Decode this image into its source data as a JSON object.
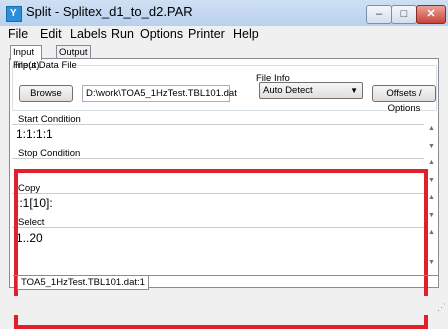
{
  "window": {
    "title": "Split - Splitex_d1_to_d2.PAR",
    "app_icon": "split-app-icon",
    "app_icon_glyph": "Y",
    "minimize_glyph": "–",
    "maximize_glyph": "□",
    "close_glyph": "✕"
  },
  "menu": [
    "File",
    "Edit",
    "Labels",
    "Run",
    "Options",
    "Printer",
    "Help"
  ],
  "tabs": [
    {
      "label": "Input File(s)",
      "active": true
    },
    {
      "label": "Output File",
      "active": false
    }
  ],
  "input_data_file": {
    "group_label": "Input Data File",
    "browse_label": "Browse",
    "path_value": "D:\\work\\TOA5_1HzTest.TBL101.dat"
  },
  "file_info": {
    "group_label": "File Info",
    "selected": "Auto Detect",
    "offsets_label": "Offsets / Options"
  },
  "sections": {
    "start_condition": {
      "label": "Start Condition",
      "value": "1:1:1:1"
    },
    "stop_condition": {
      "label": "Stop Condition",
      "value": ""
    },
    "copy": {
      "label": "Copy",
      "value": "::1[10]:"
    },
    "select": {
      "label": "Select",
      "value": "1..20"
    }
  },
  "bottom_tab": {
    "label": "TOA5_1HzTest.TBL101.dat:1"
  },
  "colors": {
    "highlight": "#e2202c",
    "titlebar": "#b9d1ee"
  }
}
